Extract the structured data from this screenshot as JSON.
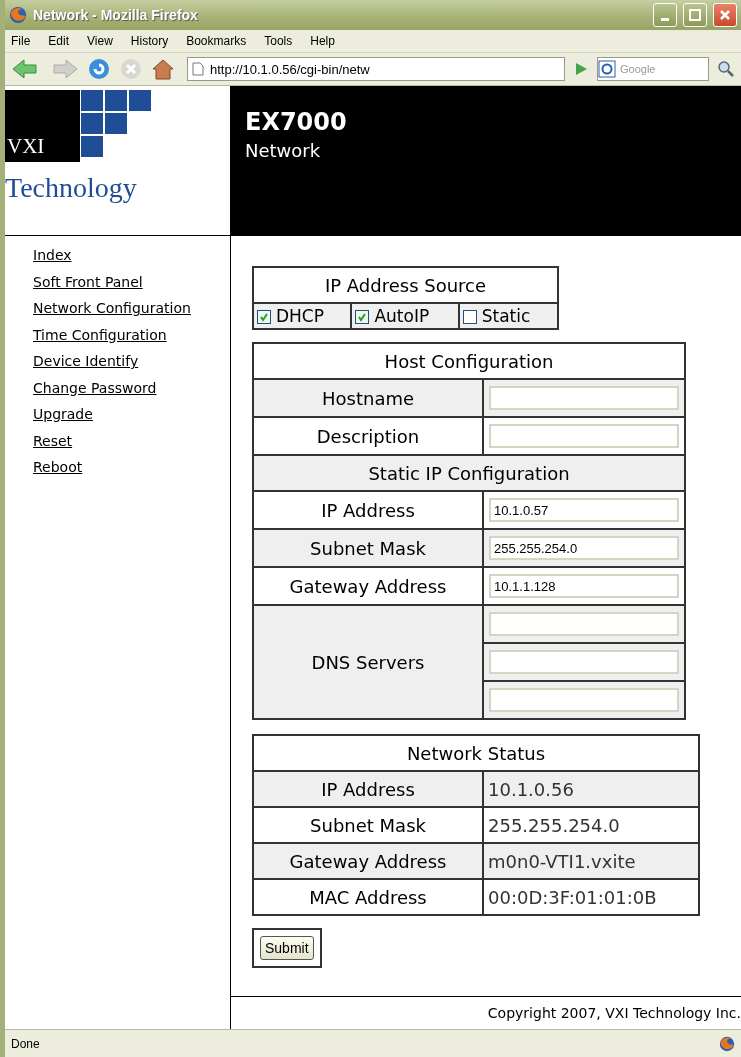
{
  "window": {
    "title": "Network - Mozilla Firefox"
  },
  "menu": [
    "File",
    "Edit",
    "View",
    "History",
    "Bookmarks",
    "Tools",
    "Help"
  ],
  "toolbar": {
    "url": "http://10.1.0.56/cgi-bin/netw",
    "search_placeholder": "Google"
  },
  "logo": {
    "line1": "VXI",
    "line2": "Technology"
  },
  "header": {
    "product": "EX7000",
    "page": "Network"
  },
  "sidebar": {
    "items": [
      "Index",
      "Soft Front Panel",
      "Network Configuration",
      "Time Configuration",
      "Device Identify",
      "Change Password",
      "Upgrade",
      "Reset",
      "Reboot"
    ]
  },
  "ip_source": {
    "title": "IP Address Source",
    "options": [
      {
        "label": "DHCP",
        "checked": true
      },
      {
        "label": "AutoIP",
        "checked": true
      },
      {
        "label": "Static",
        "checked": false
      }
    ]
  },
  "host_config": {
    "title": "Host Configuration",
    "rows": [
      {
        "kind": "field",
        "label": "Hostname",
        "values": [
          {
            "kind": "input"
          }
        ]
      },
      {
        "kind": "field",
        "label": "Description",
        "values": [
          {
            "kind": "input"
          }
        ]
      },
      {
        "kind": "section",
        "label": "Static IP Configuration"
      },
      {
        "kind": "field",
        "label": "IP Address",
        "values": [
          {
            "kind": "input",
            "value": "10.1.0.57"
          }
        ]
      },
      {
        "kind": "field",
        "label": "Subnet Mask",
        "values": [
          {
            "kind": "input",
            "value": "255.255.254.0"
          }
        ]
      },
      {
        "kind": "field",
        "label": "Gateway Address",
        "values": [
          {
            "kind": "input",
            "value": "10.1.1.128"
          }
        ]
      },
      {
        "kind": "field",
        "label": "DNS Servers",
        "values": [
          {
            "kind": "input"
          },
          {
            "kind": "input"
          },
          {
            "kind": "input"
          }
        ]
      }
    ]
  },
  "network_status": {
    "title": "Network Status",
    "rows": [
      {
        "label": "IP Address",
        "value": "10.1.0.56"
      },
      {
        "label": "Subnet Mask",
        "value": "255.255.254.0"
      },
      {
        "label": "Gateway Address",
        "value": "m0n0-VTI1.vxite"
      },
      {
        "label": "MAC Address",
        "value": "00:0D:3F:01:01:0B"
      }
    ]
  },
  "submit": "Submit",
  "footer": "Copyright 2007, VXI Technology Inc.",
  "status_bar": "Done"
}
